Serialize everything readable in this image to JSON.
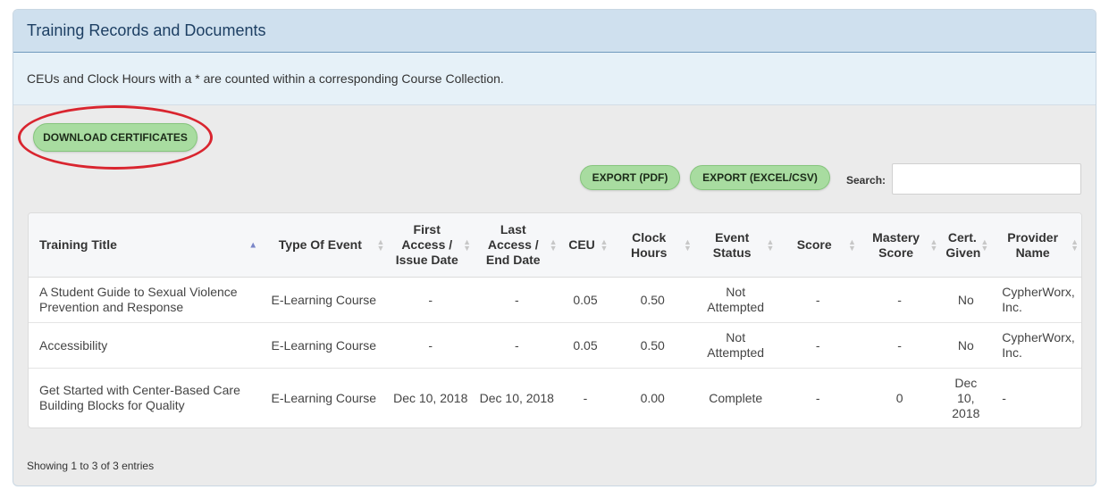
{
  "panel": {
    "title": "Training Records and Documents",
    "notice": "CEUs and Clock Hours with a * are counted within a corresponding Course Collection."
  },
  "buttons": {
    "download_certificates": "DOWNLOAD CERTIFICATES",
    "export_pdf": "EXPORT (PDF)",
    "export_excel": "EXPORT (EXCEL/CSV)"
  },
  "search": {
    "label": "Search:",
    "value": ""
  },
  "table": {
    "columns": [
      {
        "label": "Training Title",
        "sort": "asc"
      },
      {
        "label": "Type Of Event",
        "sort": "none"
      },
      {
        "label": "First Access / Issue Date",
        "sort": "none"
      },
      {
        "label": "Last Access / End Date",
        "sort": "none"
      },
      {
        "label": "CEU",
        "sort": "none"
      },
      {
        "label": "Clock Hours",
        "sort": "none"
      },
      {
        "label": "Event Status",
        "sort": "none"
      },
      {
        "label": "Score",
        "sort": "none"
      },
      {
        "label": "Mastery Score",
        "sort": "none"
      },
      {
        "label": "Cert. Given",
        "sort": "none"
      },
      {
        "label": "Provider Name",
        "sort": "none"
      }
    ],
    "rows": [
      [
        "A Student Guide to Sexual Violence Prevention and Response",
        "E-Learning Course",
        "-",
        "-",
        "0.05",
        "0.50",
        "Not Attempted",
        "-",
        "-",
        "No",
        "CypherWorx, Inc."
      ],
      [
        "Accessibility",
        "E-Learning Course",
        "-",
        "-",
        "0.05",
        "0.50",
        "Not Attempted",
        "-",
        "-",
        "No",
        "CypherWorx, Inc."
      ],
      [
        "Get Started with Center-Based Care Building Blocks for Quality",
        "E-Learning Course",
        "Dec 10, 2018",
        "Dec 10, 2018",
        "-",
        "0.00",
        "Complete",
        "-",
        "0",
        "Dec 10, 2018",
        "-"
      ]
    ]
  },
  "footer": {
    "info": "Showing 1 to 3 of 3 entries"
  },
  "colors": {
    "button_green": "#a8dca0",
    "header_blue": "#cfe0ee",
    "highlight_red": "#d9252f"
  }
}
